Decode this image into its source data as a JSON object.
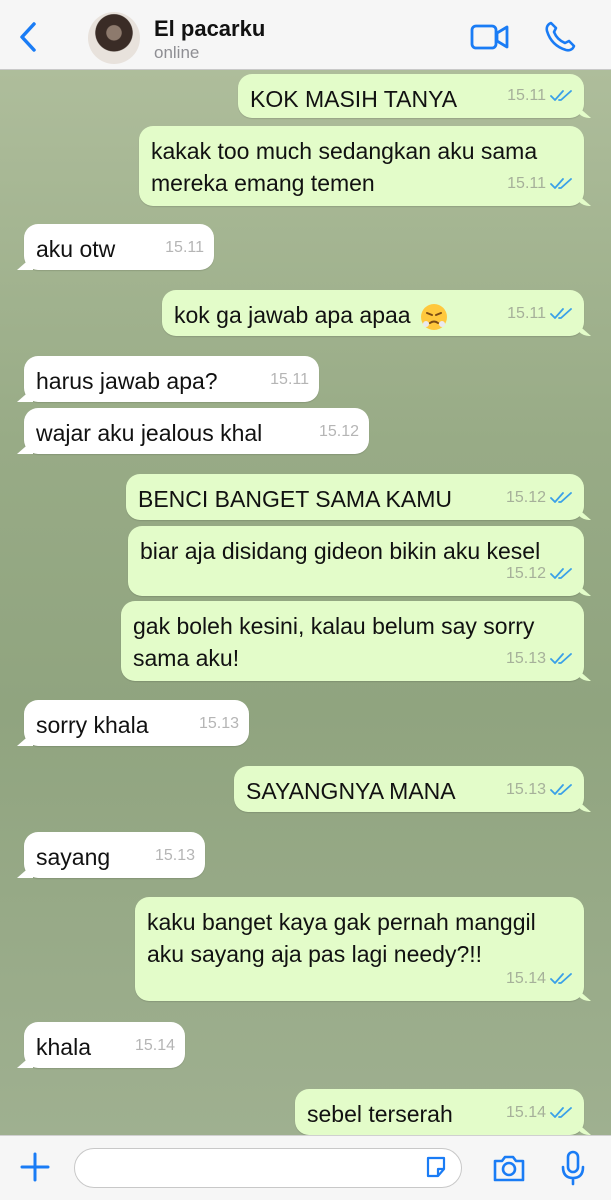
{
  "header": {
    "contact_name": "El pacarku",
    "status": "online"
  },
  "colors": {
    "accent": "#1a7cf5",
    "outgoing_bubble": "#e3fcc9",
    "incoming_bubble": "#ffffff",
    "read_ticks": "#3aa0e8"
  },
  "messages": [
    {
      "dir": "out",
      "text": "KOK MASIH TANYA",
      "time": "15.11",
      "read": true
    },
    {
      "dir": "out",
      "text": "kakak too much sedangkan aku sama mereka emang temen",
      "time": "15.11",
      "read": true
    },
    {
      "dir": "in",
      "text": "aku otw",
      "time": "15.11"
    },
    {
      "dir": "out",
      "text": "kok ga jawab apa apaa",
      "emoji": "face-with-steam-from-nose",
      "time": "15.11",
      "read": true
    },
    {
      "dir": "in",
      "text": "harus jawab apa?",
      "time": "15.11"
    },
    {
      "dir": "in",
      "text": "wajar aku jealous khal",
      "time": "15.12"
    },
    {
      "dir": "out",
      "text": "BENCI BANGET SAMA KAMU",
      "time": "15.12",
      "read": true
    },
    {
      "dir": "out",
      "text": "biar aja disidang gideon bikin aku kesel",
      "time": "15.12",
      "read": true
    },
    {
      "dir": "out",
      "text": "gak boleh kesini, kalau belum say sorry sama aku!",
      "time": "15.13",
      "read": true
    },
    {
      "dir": "in",
      "text": "sorry khala",
      "time": "15.13"
    },
    {
      "dir": "out",
      "text": "SAYANGNYA MANA",
      "time": "15.13",
      "read": true
    },
    {
      "dir": "in",
      "text": "sayang",
      "time": "15.13"
    },
    {
      "dir": "out",
      "text": "kaku banget kaya gak pernah manggil aku sayang aja pas lagi needy?!!",
      "time": "15.14",
      "read": true
    },
    {
      "dir": "in",
      "text": "khala",
      "time": "15.14"
    },
    {
      "dir": "out",
      "text": "sebel terserah",
      "time": "15.14",
      "read": true
    }
  ],
  "composer": {
    "value": "",
    "placeholder": ""
  },
  "icons": {
    "back": "chevron-left-icon",
    "video": "video-camera-icon",
    "call": "phone-icon",
    "plus": "plus-icon",
    "sticker": "sticker-icon",
    "camera": "camera-icon",
    "mic": "microphone-icon"
  }
}
